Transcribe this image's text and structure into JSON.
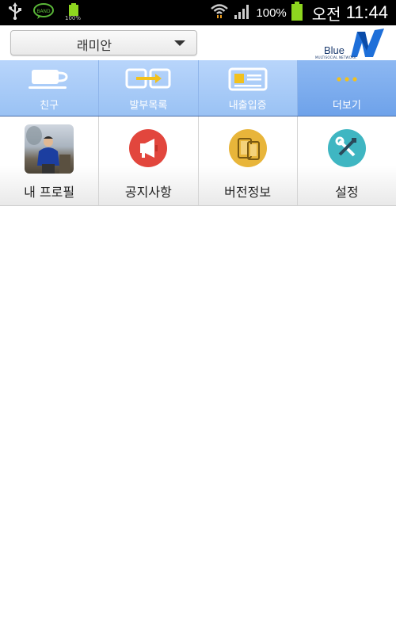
{
  "status_bar": {
    "battery_small": "100%",
    "battery_pct": "100%",
    "ampm": "오전",
    "time": "11:44"
  },
  "header": {
    "selector_value": "래미안",
    "logo_text": "Blue",
    "logo_subtext": "MULTISOCIAL NETWORK"
  },
  "tabs": [
    {
      "label": "친구",
      "icon": "cup-icon",
      "active": false
    },
    {
      "label": "발부목록",
      "icon": "transfer-icon",
      "active": false
    },
    {
      "label": "내출입증",
      "icon": "id-card-icon",
      "active": false
    },
    {
      "label": "더보기",
      "icon": "more-dots-icon",
      "active": true
    }
  ],
  "grid": [
    {
      "label": "내 프로필",
      "icon": "profile-photo"
    },
    {
      "label": "공지사항",
      "icon": "megaphone-icon",
      "color": "#e2463d"
    },
    {
      "label": "버전정보",
      "icon": "devices-icon",
      "color": "#e8b53a"
    },
    {
      "label": "설정",
      "icon": "tools-icon",
      "color": "#3fb6c2"
    }
  ],
  "colors": {
    "tab_bg": "#9ac2f4",
    "tab_active_bg": "#6ea2ea",
    "battery_green": "#8ed61f"
  }
}
